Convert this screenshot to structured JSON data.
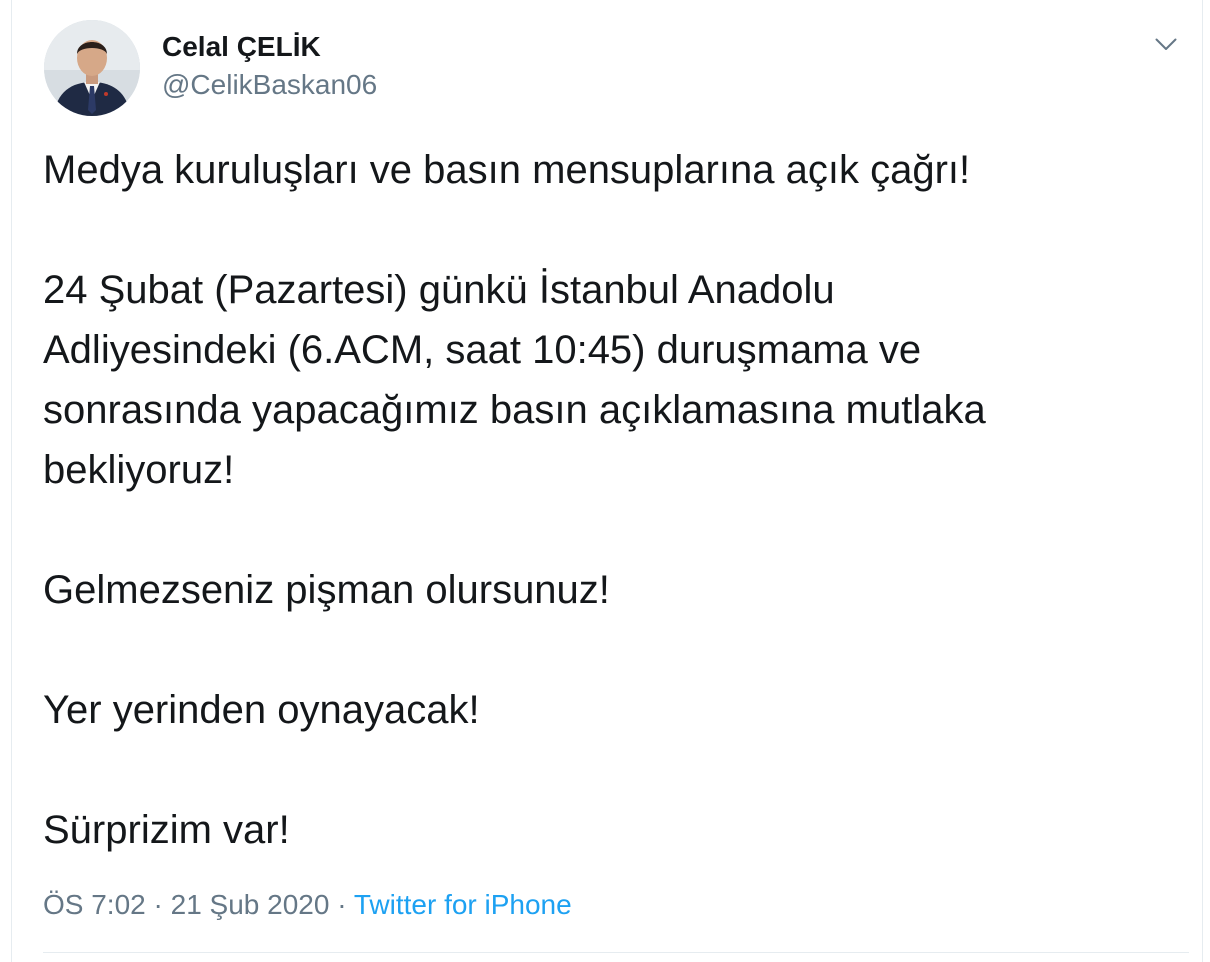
{
  "tweet": {
    "author_name": "Celal ÇELİK",
    "author_handle": "@CelikBaskan06",
    "menu_icon": "chevron-down-icon",
    "paragraphs": [
      "Medya kuruluşları ve basın mensuplarına açık çağrı!",
      "24 Şubat (Pazartesi) günkü İstanbul Anadolu\nAdliyesindeki (6.ACM, saat 10:45) duruşmama ve\nsonrasında yapacağımız basın açıklamasına mutlaka\nbekliyoruz!",
      "Gelmezseniz pişman olursunuz!",
      "Yer yerinden oynayacak!",
      "Sürprizim var!"
    ],
    "time": "ÖS 7:02",
    "separator": "·",
    "date": "21 Şub 2020",
    "source": "Twitter for iPhone"
  },
  "colors": {
    "text": "#14171a",
    "secondary": "#657786",
    "link": "#1da1f2",
    "border": "#e6ecf0"
  }
}
